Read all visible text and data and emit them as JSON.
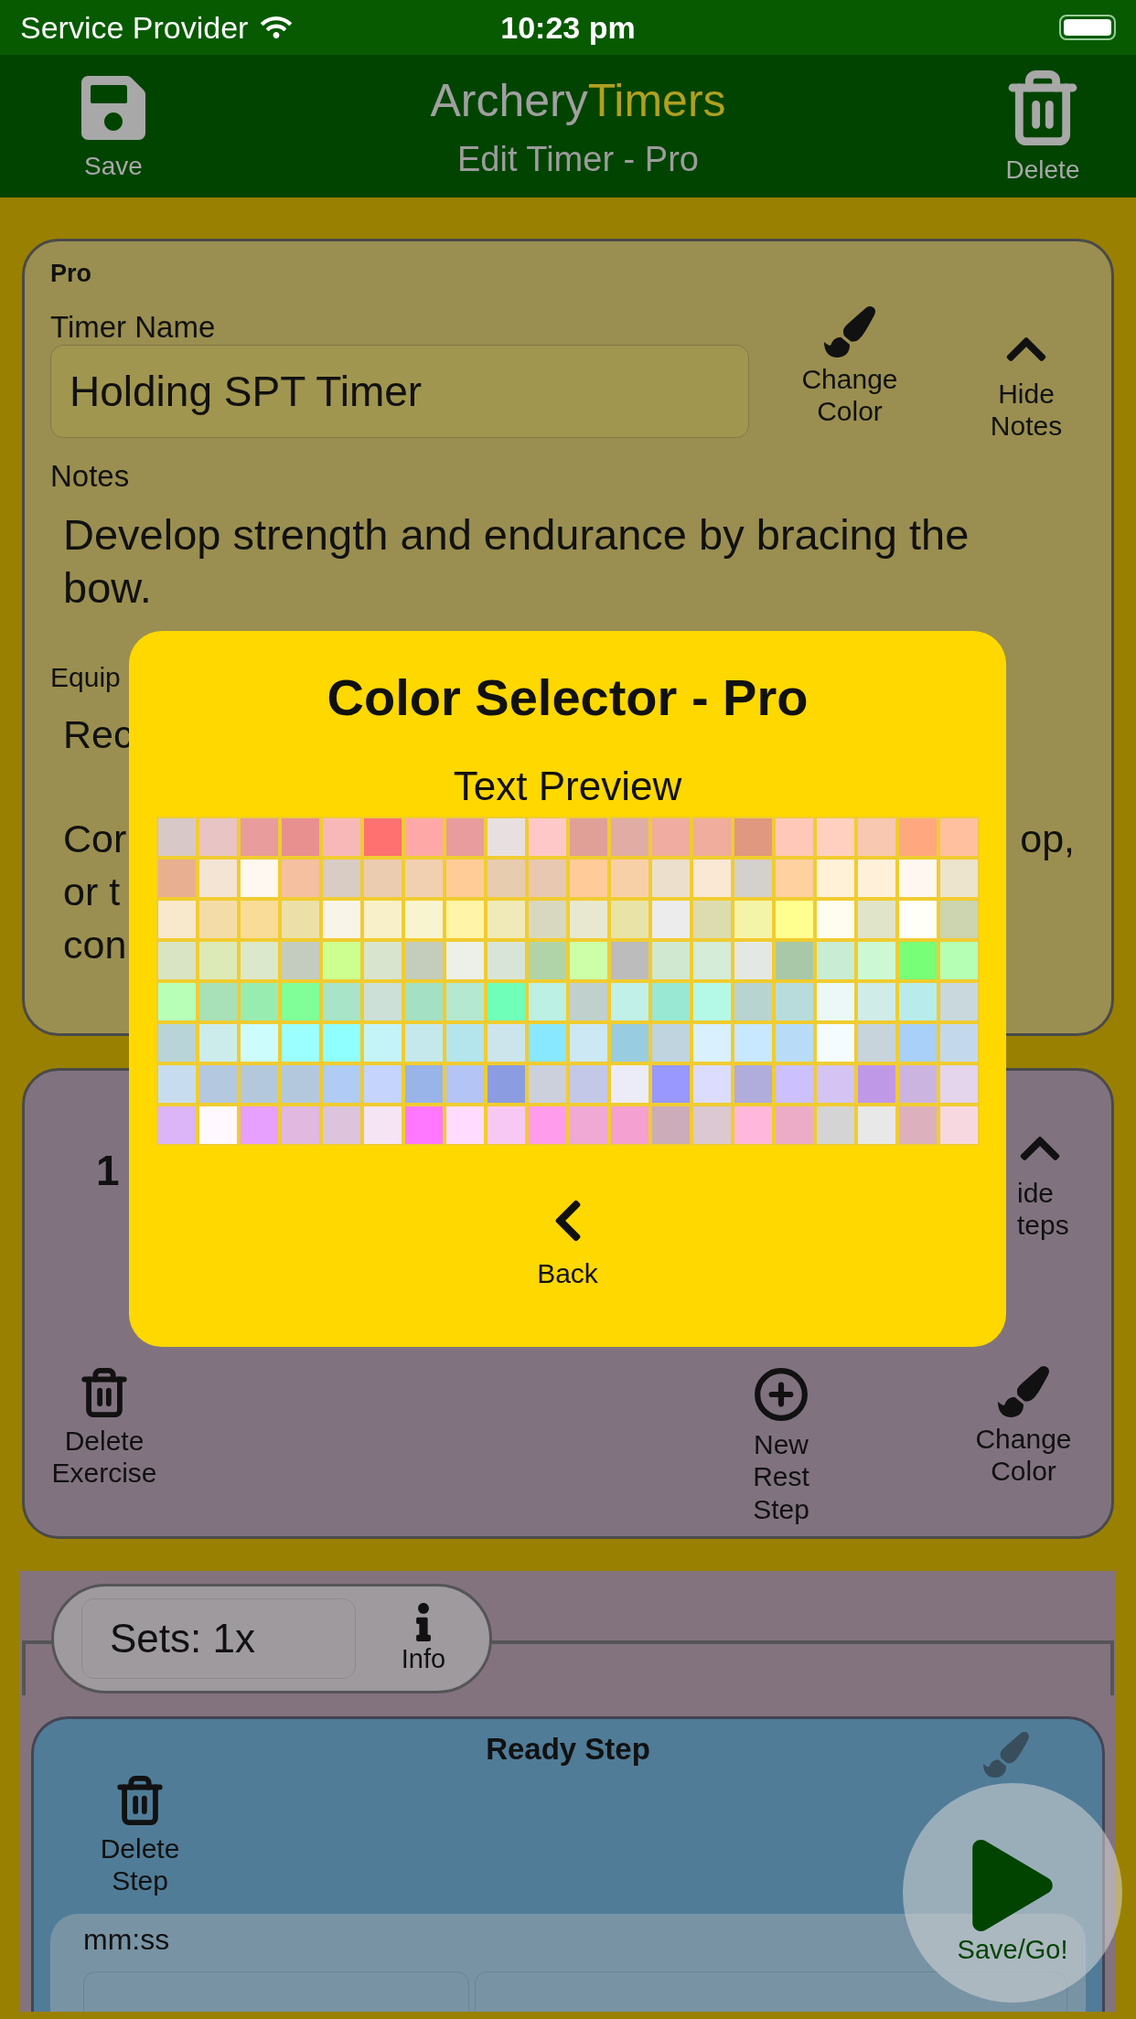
{
  "status_bar": {
    "carrier": "Service Provider",
    "time": "10:23 pm"
  },
  "nav_bar": {
    "title_first": "Archery",
    "title_second": "Timers",
    "subtitle": "Edit Timer - Pro",
    "save": "Save",
    "delete": "Delete"
  },
  "timer_card": {
    "badge": "Pro",
    "name_label": "Timer Name",
    "name_value": "Holding SPT Timer",
    "change_color": "Change Color",
    "hide_notes": "Hide Notes",
    "notes_label": "Notes",
    "notes": "Develop strength and endurance by bracing the bow.",
    "equipment_label": "Equip",
    "equipment_line_1": "Rec",
    "equipment_line_2": "Cor",
    "equipment_line_2_end": "op,",
    "equipment_line_3": "or t",
    "equipment_line_4": "con"
  },
  "exercise_card": {
    "number": "1",
    "hide_steps": "ide\nteps",
    "delete_exercise": "Delete Exercise",
    "new_rest_step": "New Rest Step",
    "change_color": "Change Color"
  },
  "sets": {
    "value": "Sets: 1x",
    "info": "Info"
  },
  "step_card": {
    "title": "Ready Step",
    "delete_step": "Delete Step",
    "time_label": "mm:ss"
  },
  "fab": {
    "label": "Save/Go!"
  },
  "color_selector": {
    "title": "Color Selector - Pro",
    "preview": "Text Preview",
    "back": "Back",
    "swatches": [
      {
        "color": "#d8c8c8"
      },
      {
        "color": "#e8c4c4"
      },
      {
        "color": "#e89c9c"
      },
      {
        "color": "#e89090"
      },
      {
        "color": "#f8b8b8"
      },
      {
        "color": "#ff7070"
      },
      {
        "color": "#ffa8a8"
      },
      {
        "color": "#e89c9d"
      },
      {
        "color": "#e8e0e0"
      },
      {
        "color": "#ffc8c8"
      },
      {
        "color": "#e0a098"
      },
      {
        "color": "#e0aca4"
      },
      {
        "color": "#f0aca0"
      },
      {
        "color": "#f0ac9c"
      },
      {
        "color": "#e09880"
      },
      {
        "color": "#ffc8b8"
      },
      {
        "color": "#ffd0c0"
      },
      {
        "color": "#f8c8b0"
      },
      {
        "color": "#ffa880"
      },
      {
        "color": "#ffc0a0"
      },
      {
        "color": "#e8b090"
      },
      {
        "color": "#f4e4d4"
      },
      {
        "color": "#fff8f0"
      },
      {
        "color": "#f4c0a0"
      },
      {
        "color": "#d8ccc4"
      },
      {
        "color": "#ecccb0"
      },
      {
        "color": "#f0d0b0"
      },
      {
        "color": "#ffcc98"
      },
      {
        "color": "#e8ccb0"
      },
      {
        "color": "#e8c8b0"
      },
      {
        "color": "#ffcc99"
      },
      {
        "color": "#f8d0a8"
      },
      {
        "color": "#ece0cc"
      },
      {
        "color": "#f8e8d4"
      },
      {
        "color": "#d4d0cc"
      },
      {
        "color": "#ffd0a0"
      },
      {
        "color": "#fff0d8"
      },
      {
        "color": "#fff0d9"
      },
      {
        "color": "#fff8f1"
      },
      {
        "color": "#ece4cc"
      },
      {
        "color": "#f8e8cc"
      },
      {
        "color": "#f4dca8"
      },
      {
        "color": "#f8dc98"
      },
      {
        "color": "#ece0a8"
      },
      {
        "color": "#f8f4e8"
      },
      {
        "color": "#f8f0c8"
      },
      {
        "color": "#f8f4d0"
      },
      {
        "color": "#fff4a8"
      },
      {
        "color": "#f0eab8"
      },
      {
        "color": "#d8d8c0"
      },
      {
        "color": "#e8e8d0"
      },
      {
        "color": "#e8e4a8"
      },
      {
        "color": "#ececec"
      },
      {
        "color": "#dcdcb0"
      },
      {
        "color": "#f4f4a8"
      },
      {
        "color": "#ffff90"
      },
      {
        "color": "#fffcf0"
      },
      {
        "color": "#e0e4c8"
      },
      {
        "color": "#fffff8"
      },
      {
        "color": "#ccd4b0"
      },
      {
        "color": "#d8e4c4"
      },
      {
        "color": "#dceab8"
      },
      {
        "color": "#dce8cc"
      },
      {
        "color": "#c4ccc0"
      },
      {
        "color": "#ccff90"
      },
      {
        "color": "#d8e4cd"
      },
      {
        "color": "#c4ccbc"
      },
      {
        "color": "#ecf0e8"
      },
      {
        "color": "#d8e4d8"
      },
      {
        "color": "#b0d4a8"
      },
      {
        "color": "#ccffa8"
      },
      {
        "color": "#bcbcbc"
      },
      {
        "color": "#d0e8d0"
      },
      {
        "color": "#d4ecd8"
      },
      {
        "color": "#e4e8e4"
      },
      {
        "color": "#a8c8a8"
      },
      {
        "color": "#c8ecd4"
      },
      {
        "color": "#ccf8d4"
      },
      {
        "color": "#78ff78"
      },
      {
        "color": "#b4ffb4"
      },
      {
        "color": "#b8ffb8"
      },
      {
        "color": "#a8e0b8"
      },
      {
        "color": "#98ecb0"
      },
      {
        "color": "#80ff98"
      },
      {
        "color": "#a8e4c8"
      },
      {
        "color": "#cce0d8"
      },
      {
        "color": "#a4e0c4"
      },
      {
        "color": "#b4e8d0"
      },
      {
        "color": "#70ffb8"
      },
      {
        "color": "#bcf0e4"
      },
      {
        "color": "#c0d0cc"
      },
      {
        "color": "#c0f0e8"
      },
      {
        "color": "#98e8d4"
      },
      {
        "color": "#b4f8e8"
      },
      {
        "color": "#b8d4d0"
      },
      {
        "color": "#b8dcdc"
      },
      {
        "color": "#ecf8f8"
      },
      {
        "color": "#d0ece8"
      },
      {
        "color": "#b8ecec"
      },
      {
        "color": "#c8d8dc"
      },
      {
        "color": "#b8d4d8"
      },
      {
        "color": "#ccecec"
      },
      {
        "color": "#ccfcfc"
      },
      {
        "color": "#9cffff"
      },
      {
        "color": "#90ffff"
      },
      {
        "color": "#c4f4f8"
      },
      {
        "color": "#c4e8ec"
      },
      {
        "color": "#b4e4ec"
      },
      {
        "color": "#cce4ec"
      },
      {
        "color": "#88e8ff"
      },
      {
        "color": "#cce8f4"
      },
      {
        "color": "#98cce0"
      },
      {
        "color": "#c0d4e0"
      },
      {
        "color": "#d8f0ff"
      },
      {
        "color": "#c8e8ff"
      },
      {
        "color": "#b8dcf8"
      },
      {
        "color": "#f4fcff"
      },
      {
        "color": "#c8d4dc"
      },
      {
        "color": "#a8d0f8"
      },
      {
        "color": "#c4d8ec"
      },
      {
        "color": "#c8dcf0"
      },
      {
        "color": "#b4c8e0"
      },
      {
        "color": "#b4c8dc"
      },
      {
        "color": "#b4c8dd"
      },
      {
        "color": "#b0ccf4"
      },
      {
        "color": "#c4d4fc"
      },
      {
        "color": "#98b4e8"
      },
      {
        "color": "#b4c4f4"
      },
      {
        "color": "#8c9ce0"
      },
      {
        "color": "#ccd0dc"
      },
      {
        "color": "#c4c8e8"
      },
      {
        "color": "#ececf8"
      },
      {
        "color": "#9898ff"
      },
      {
        "color": "#dcdcfc"
      },
      {
        "color": "#b0acdc"
      },
      {
        "color": "#ccc0ff"
      },
      {
        "color": "#d4c4f4"
      },
      {
        "color": "#c098e8"
      },
      {
        "color": "#ccb4e0"
      },
      {
        "color": "#e4d4ec"
      },
      {
        "color": "#dcb4f8"
      },
      {
        "color": "#fff8ff"
      },
      {
        "color": "#e8a0ff"
      },
      {
        "color": "#e0b8e0"
      },
      {
        "color": "#dcc4dc"
      },
      {
        "color": "#f4e4f4"
      },
      {
        "color": "#ff78ff"
      },
      {
        "color": "#ffdcff"
      },
      {
        "color": "#f8c8f4"
      },
      {
        "color": "#ff9cec"
      },
      {
        "color": "#f0a8d4"
      },
      {
        "color": "#f4a0d0"
      },
      {
        "color": "#ccacb8"
      },
      {
        "color": "#dcc8d0"
      },
      {
        "color": "#ffb8dc"
      },
      {
        "color": "#ecacc8"
      },
      {
        "color": "#d4d4d4"
      },
      {
        "color": "#e8e8e8"
      },
      {
        "color": "#dcb0bc"
      },
      {
        "color": "#f8d8e0"
      }
    ]
  }
}
